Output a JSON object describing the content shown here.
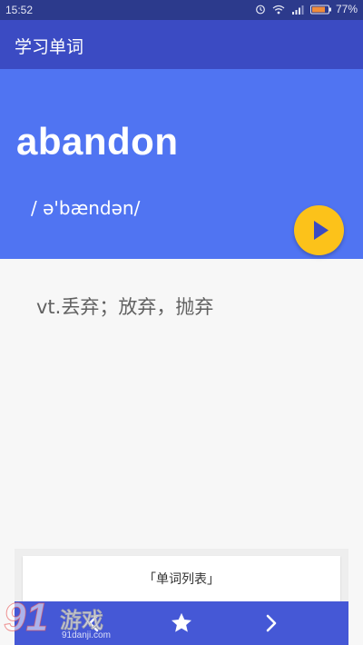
{
  "status_bar": {
    "time": "15:52",
    "battery": "77%",
    "icons": [
      "alarm-icon",
      "wifi-icon",
      "signal-icon",
      "battery-icon"
    ]
  },
  "app_bar": {
    "title": "学习单词"
  },
  "word_card": {
    "word": "abandon",
    "phonetic": "/ ə'bændən/",
    "play_icon": "play-icon"
  },
  "definition": "vt.丢弃；放弃，抛弃",
  "word_list_button": {
    "label": "「单词列表」"
  },
  "bottom_nav": {
    "prev_icon": "chevron-left-icon",
    "favorite_icon": "star-icon",
    "next_icon": "chevron-right-icon"
  },
  "watermark": {
    "logo": "91",
    "name": "游戏",
    "url": "91danji.com"
  },
  "colors": {
    "status_bar": "#2c3a8c",
    "app_bar": "#3b4bc3",
    "word_header": "#5074f2",
    "play_button": "#fcc21a",
    "bottom_bar": "#4558d6",
    "definition_text": "#616161"
  }
}
